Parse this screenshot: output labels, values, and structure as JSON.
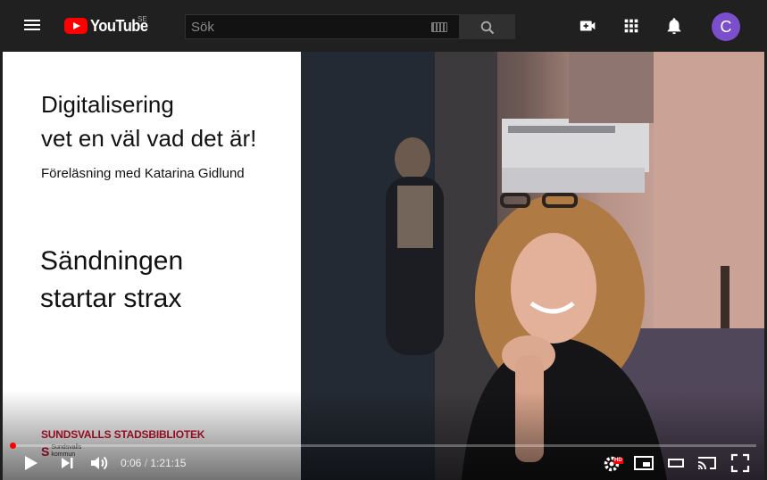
{
  "masthead": {
    "logo_text": "YouTube",
    "country_code": "SE",
    "search": {
      "placeholder": "Sök"
    },
    "avatar_letter": "C",
    "icons": [
      "menu-icon",
      "keyboard-icon",
      "search-icon",
      "create-video-icon",
      "apps-icon",
      "notifications-icon"
    ],
    "colors": {
      "background": "#202020",
      "brand_red": "#ff0000",
      "avatar": "#7b4fcb"
    }
  },
  "video": {
    "slide": {
      "title_line1": "Digitalisering",
      "title_line2": "vet en väl vad det är!",
      "subtitle": "Föreläsning med Katarina Gidlund",
      "status_line1": "Sändningen",
      "status_line2": "startar strax",
      "library_logo": "SUNDSVALLS STADSBIBLIOTEK",
      "kommun_logo_line1": "Sundsvalls",
      "kommun_logo_line2": "kommun"
    },
    "player": {
      "current_time": "0:06",
      "separator": "/",
      "duration": "1:21:15",
      "progress_fraction": 0.0012,
      "quality_badge": "HD",
      "controls": [
        "play-icon",
        "next-icon",
        "volume-icon",
        "settings-icon",
        "miniplayer-icon",
        "theater-mode-icon",
        "cast-icon",
        "fullscreen-icon"
      ]
    }
  }
}
